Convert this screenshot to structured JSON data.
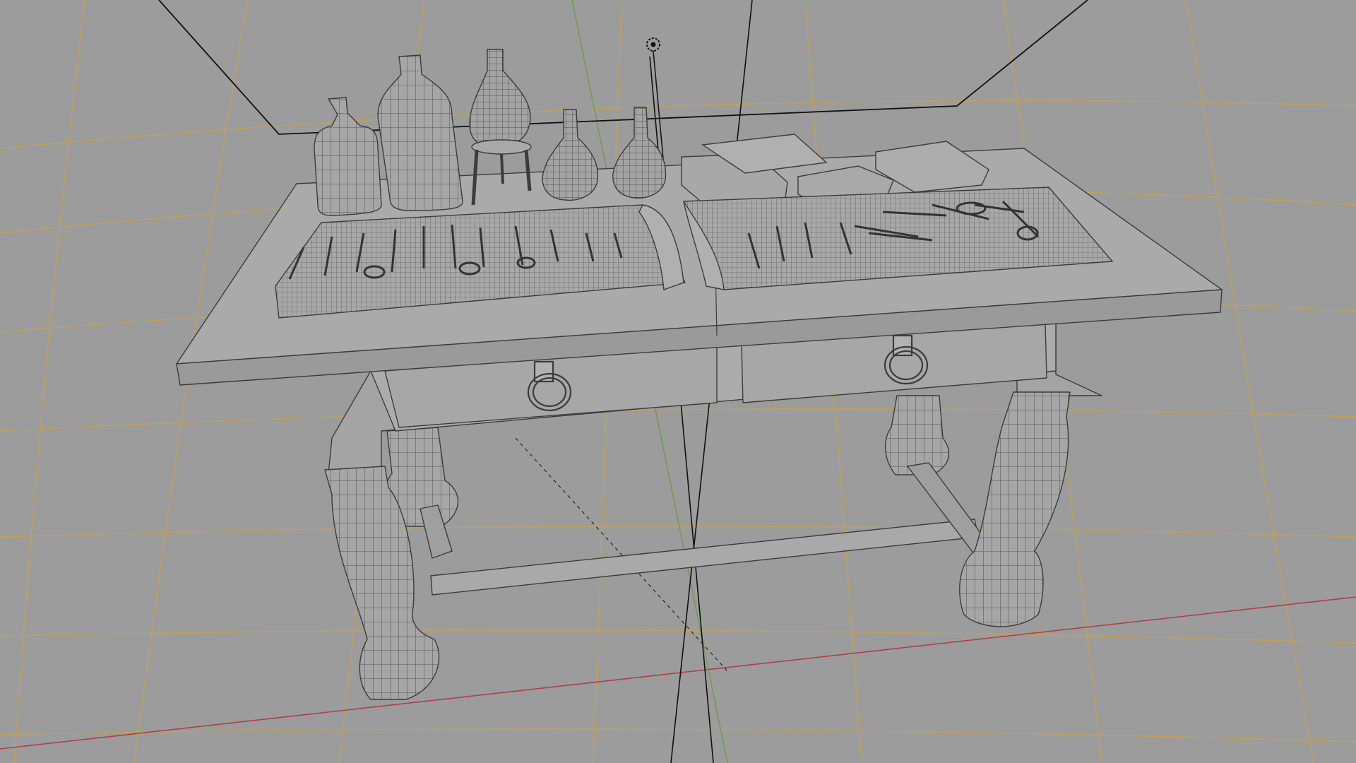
{
  "viewport": {
    "background_color": "#9c9c9c",
    "grid_color": "#c9a24a",
    "x_axis_color": "#b0404a",
    "y_axis_color": "#6e9a4e",
    "model_fill": "#a9a9a9",
    "model_shade": "#8f8f8f",
    "wire_color": "#3c3c3c",
    "light_icon": "light-icon"
  }
}
